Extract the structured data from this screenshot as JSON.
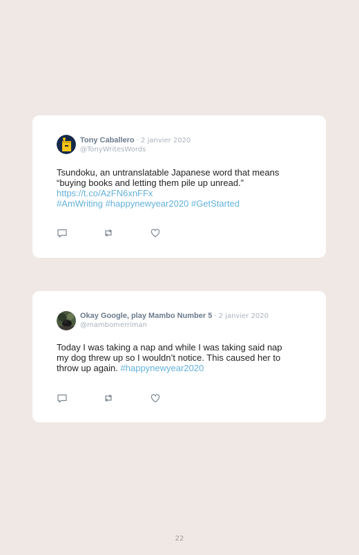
{
  "tweets": [
    {
      "name": "Tony Caballero",
      "separator": "·",
      "date": "2 janvier 2020",
      "handle": "@TonyWritesWords",
      "text_line1": "Tsundoku, an untranslatable Japanese word that means",
      "text_line2": "“buying books and letting them pile up unread.”",
      "link": "https://t.co/AzFN6xnFFx",
      "hashtags": [
        "#AmWriting",
        "#happynewyear2020",
        "#GetStarted"
      ],
      "avatar_icon": "book-character-avatar"
    },
    {
      "name": "Okay Google, play Mambo Number 5",
      "separator": "·",
      "date": "2 janvier 2020",
      "handle": "@mambomerriman",
      "text": "Today I was taking a nap and while I was taking said nap my dog threw up so I wouldn’t notice. This caused her to throw up again.",
      "hashtag": "#happynewyear2020",
      "avatar_icon": "photo-avatar"
    }
  ],
  "actions": [
    "reply-icon",
    "retweet-icon",
    "like-icon"
  ],
  "colors": {
    "background": "#efe8e4",
    "card": "#ffffff",
    "link": "#63b1dd",
    "name": "#6b7b8c",
    "muted": "#a9b3bd"
  },
  "page_number": "22"
}
